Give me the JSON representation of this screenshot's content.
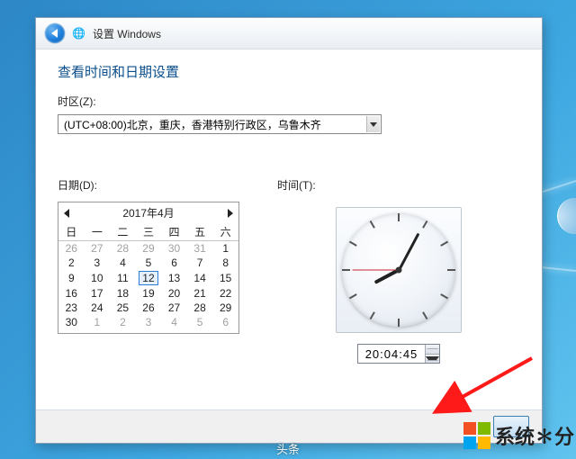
{
  "header": {
    "title": "设置 Windows"
  },
  "main": {
    "heading": "查看时间和日期设置",
    "timezone_label": "时区(Z):",
    "timezone_value": "(UTC+08:00)北京，重庆，香港特别行政区，乌鲁木齐",
    "date_label": "日期(D):",
    "time_label": "时间(T):",
    "time_value": "20:04:45"
  },
  "calendar": {
    "month_title": "2017年4月",
    "weekdays": [
      "日",
      "一",
      "二",
      "三",
      "四",
      "五",
      "六"
    ],
    "rows": [
      [
        {
          "d": "26",
          "dim": true
        },
        {
          "d": "27",
          "dim": true
        },
        {
          "d": "28",
          "dim": true
        },
        {
          "d": "29",
          "dim": true
        },
        {
          "d": "30",
          "dim": true
        },
        {
          "d": "31",
          "dim": true
        },
        {
          "d": "1"
        }
      ],
      [
        {
          "d": "2"
        },
        {
          "d": "3"
        },
        {
          "d": "4"
        },
        {
          "d": "5"
        },
        {
          "d": "6"
        },
        {
          "d": "7"
        },
        {
          "d": "8"
        }
      ],
      [
        {
          "d": "9"
        },
        {
          "d": "10"
        },
        {
          "d": "11"
        },
        {
          "d": "12",
          "today": true
        },
        {
          "d": "13"
        },
        {
          "d": "14"
        },
        {
          "d": "15"
        }
      ],
      [
        {
          "d": "16"
        },
        {
          "d": "17"
        },
        {
          "d": "18"
        },
        {
          "d": "19"
        },
        {
          "d": "20"
        },
        {
          "d": "21"
        },
        {
          "d": "22"
        }
      ],
      [
        {
          "d": "23"
        },
        {
          "d": "24"
        },
        {
          "d": "25"
        },
        {
          "d": "26"
        },
        {
          "d": "27"
        },
        {
          "d": "28"
        },
        {
          "d": "29"
        }
      ],
      [
        {
          "d": "30"
        },
        {
          "d": "1",
          "dim": true
        },
        {
          "d": "2",
          "dim": true
        },
        {
          "d": "3",
          "dim": true
        },
        {
          "d": "4",
          "dim": true
        },
        {
          "d": "5",
          "dim": true
        },
        {
          "d": "6",
          "dim": true
        }
      ]
    ]
  },
  "clock_hands": {
    "hour_angle": 242,
    "minute_angle": 28,
    "second_angle": 270
  },
  "watermark": {
    "text": "系统✽分"
  },
  "caption": "头条"
}
